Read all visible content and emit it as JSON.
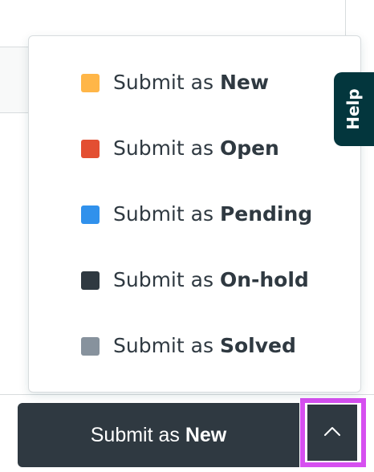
{
  "dropdown": {
    "items": [
      {
        "prefix": "Submit as ",
        "status": "New",
        "color": "#ffb648"
      },
      {
        "prefix": "Submit as ",
        "status": "Open",
        "color": "#e34f32"
      },
      {
        "prefix": "Submit as ",
        "status": "Pending",
        "color": "#3091ec"
      },
      {
        "prefix": "Submit as ",
        "status": "On-hold",
        "color": "#2f3941"
      },
      {
        "prefix": "Submit as ",
        "status": "Solved",
        "color": "#87929d"
      }
    ]
  },
  "help_tab": {
    "label": "Help"
  },
  "submit_button": {
    "prefix": "Submit as ",
    "status": "New"
  },
  "submit_toggle": {
    "icon": "chevron-up-icon",
    "expanded": true
  },
  "colors": {
    "button_bg": "#2f3941",
    "help_bg": "#03363d",
    "highlight": "#d64ff0"
  }
}
